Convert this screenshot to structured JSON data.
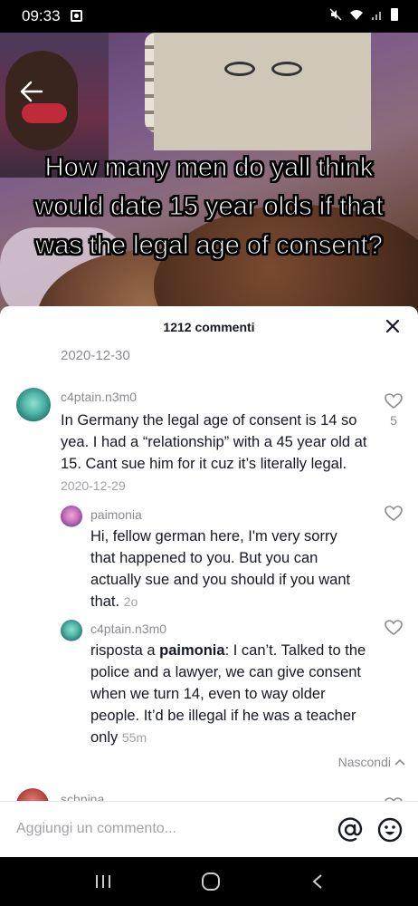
{
  "status_bar": {
    "time": "09:33"
  },
  "video": {
    "overlay_text": "How many men do yall think would date 15 year olds if that was the legal age of consent?"
  },
  "comments_sheet": {
    "title": "1212 commenti",
    "date_line": "2020-12-30",
    "comments": [
      {
        "username": "c4ptain.n3m0",
        "text": "In Germany the legal age of consent is 14 so yea. I had a “relationship” with a 45 year old at 15. Cant sue him for it cuz it’s literally legal.",
        "time": "2020-12-29",
        "likes": "5"
      },
      {
        "username": "paimonia",
        "text": "Hi, fellow german here, I'm very sorry that happened to you. But you can actually sue and you should if you want that.",
        "time": "2o"
      },
      {
        "username": "c4ptain.n3m0",
        "reply_prefix": "risposta a",
        "mention": "paimonia",
        "text": ": I can’t. Talked to the police and a lawyer, we can give consent when we turn 14, even to way older people. It’d be illegal if he was a teacher only",
        "time": "55m"
      },
      {
        "username": "schpina"
      }
    ],
    "hide_label": "Nascondi"
  },
  "input_bar": {
    "placeholder": "Aggiungi un commento..."
  },
  "icons": {
    "back": "back-arrow-icon",
    "close": "close-icon",
    "heart": "heart-icon",
    "at": "at-mention-icon",
    "emoji": "emoji-icon"
  }
}
